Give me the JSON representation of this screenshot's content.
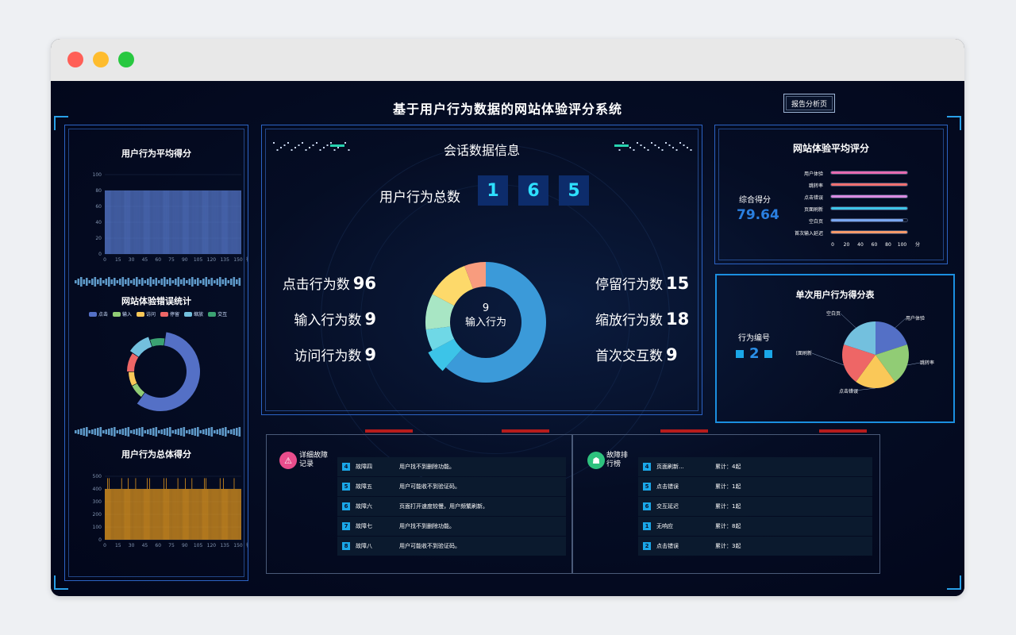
{
  "window": {
    "title": "基于用户行为数据的网站体验评分系统",
    "report_button": "报告分析页"
  },
  "left": {
    "avg_score_title": "用户行为平均得分",
    "avg_chart": {
      "type": "bar",
      "yticks": [
        "100",
        "80",
        "60",
        "40",
        "20",
        "0"
      ],
      "xticks": [
        "0",
        "15",
        "30",
        "45",
        "60",
        "75",
        "90",
        "105",
        "120",
        "135",
        "150"
      ],
      "xunit": "行为",
      "ylim": [
        0,
        100
      ],
      "value": 80,
      "count": 165,
      "color": "#5b7fd6"
    },
    "error_title": "网站体验错误统计",
    "error_legend": [
      {
        "label": "点击",
        "color": "#5470c6"
      },
      {
        "label": "输入",
        "color": "#91cc75"
      },
      {
        "label": "访问",
        "color": "#fac858"
      },
      {
        "label": "停留",
        "color": "#ee6666"
      },
      {
        "label": "缩放",
        "color": "#73c0de"
      },
      {
        "label": "交互",
        "color": "#3ba272"
      }
    ],
    "total_score_title": "用户行为总体得分",
    "total_chart": {
      "type": "bar",
      "yticks": [
        "500",
        "400",
        "300",
        "200",
        "100",
        "0"
      ],
      "xticks": [
        "0",
        "15",
        "30",
        "45",
        "60",
        "75",
        "90",
        "105",
        "120",
        "135",
        "150"
      ],
      "xunit": "行为",
      "ylim": [
        0,
        500
      ],
      "value": 400,
      "color": "#f0a01e"
    }
  },
  "center": {
    "title": "会话数据信息",
    "total_label": "用户行为总数",
    "total_digits": [
      "1",
      "6",
      "5"
    ],
    "stats_left": [
      {
        "label": "点击行为数",
        "value": "96"
      },
      {
        "label": "输入行为数",
        "value": "9"
      },
      {
        "label": "访问行为数",
        "value": "9"
      }
    ],
    "stats_right": [
      {
        "label": "停留行为数",
        "value": "15"
      },
      {
        "label": "缩放行为数",
        "value": "18"
      },
      {
        "label": "首次交互数",
        "value": "9"
      }
    ],
    "donut_center_value": "9",
    "donut_center_label": "输入行为",
    "chart_data": {
      "type": "pie",
      "categories": [
        "点击",
        "输入",
        "访问",
        "停留",
        "缩放",
        "首次交互"
      ],
      "values": [
        96,
        9,
        9,
        15,
        18,
        9
      ],
      "colors": [
        "#3b9ad9",
        "#3cc4e8",
        "#6fd8e6",
        "#a8e6c4",
        "#fdd96a",
        "#f89c7e"
      ]
    }
  },
  "right_top": {
    "title": "网站体验平均评分",
    "score_label": "综合得分",
    "score_value": "79.64",
    "bars": [
      {
        "label": "用户体验",
        "value": 100,
        "color": "#e66bb0"
      },
      {
        "label": "跳转率",
        "value": 100,
        "color": "#f07070"
      },
      {
        "label": "点击错误",
        "value": 100,
        "color": "#d98be0"
      },
      {
        "label": "页面刷新",
        "value": 100,
        "color": "#3ec5e8"
      },
      {
        "label": "空白页",
        "value": 95,
        "color": "#7aa6f0"
      },
      {
        "label": "首次输入延迟",
        "value": 100,
        "color": "#f59a6b"
      }
    ],
    "xticks": [
      "0",
      "20",
      "40",
      "60",
      "80",
      "100"
    ],
    "xunit": "分"
  },
  "right_mid": {
    "title": "单次用户行为得分表",
    "id_label": "行为编号",
    "id_value": "2",
    "chart_data": {
      "type": "pie",
      "categories": [
        "用户体验",
        "跳转率",
        "点击错误",
        "页面刷新",
        "空白页"
      ],
      "values": [
        20,
        20,
        20,
        20,
        20
      ],
      "colors": [
        "#5470c6",
        "#91cc75",
        "#fac858",
        "#ee6666",
        "#73c0de"
      ]
    }
  },
  "bottom": {
    "fault_title": "详细故障记录",
    "fault_rows": [
      {
        "no": "4",
        "name": "故障四",
        "desc": "用户找不到删除功能。"
      },
      {
        "no": "5",
        "name": "故障五",
        "desc": "用户可能收不到验证码。"
      },
      {
        "no": "6",
        "name": "故障六",
        "desc": "页面打开速度较慢，用户频繁刷新。"
      },
      {
        "no": "7",
        "name": "故障七",
        "desc": "用户找不到删除功能。"
      },
      {
        "no": "8",
        "name": "故障八",
        "desc": "用户可能收不到验证码。"
      }
    ],
    "rank_title": "故障排行榜",
    "rank_rows": [
      {
        "no": "4",
        "name": "页面刷新...",
        "count": "累计：4起"
      },
      {
        "no": "5",
        "name": "点击错误",
        "count": "累计：1起"
      },
      {
        "no": "6",
        "name": "交互延迟",
        "count": "累计：1起"
      },
      {
        "no": "1",
        "name": "无响应",
        "count": "累计：8起"
      },
      {
        "no": "2",
        "name": "点击错误",
        "count": "累计：3起"
      }
    ]
  }
}
